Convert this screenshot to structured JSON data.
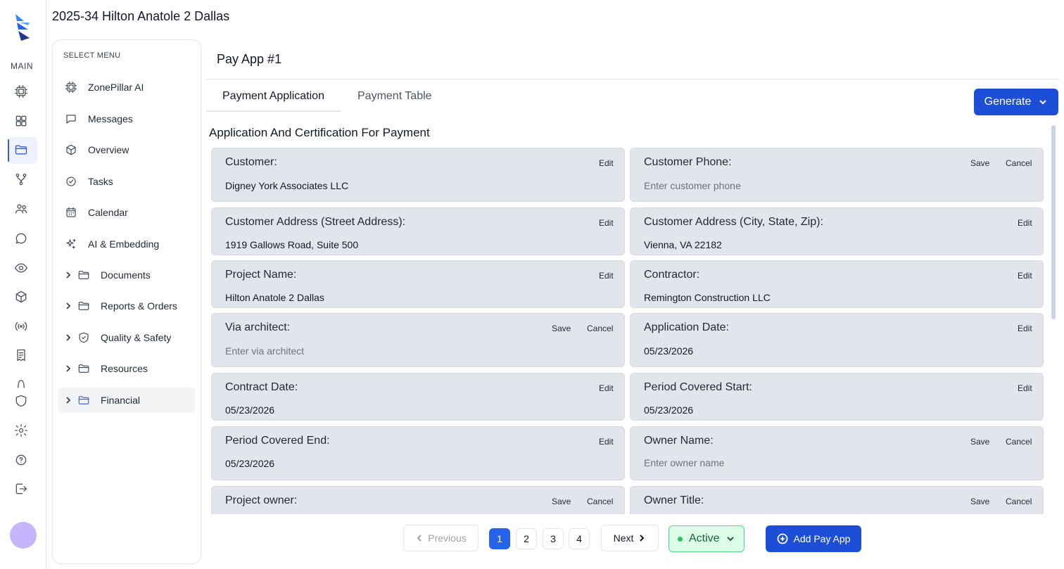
{
  "project_title": "2025-34 Hilton Anatole 2 Dallas",
  "rail": {
    "section_label": "MAIN",
    "icons": [
      "chip-icon",
      "grid-icon",
      "folder-icon",
      "branch-icon",
      "users-icon",
      "chat-icon",
      "eye-icon",
      "cube-icon",
      "broadcast-icon",
      "receipt-icon",
      "shield-icon",
      "settings-icon",
      "help-icon",
      "logout-icon"
    ]
  },
  "menu": {
    "heading": "SELECT MENU",
    "items": [
      {
        "label": "ZonePillar AI",
        "icon": "chip-icon"
      },
      {
        "label": "Messages",
        "icon": "message-icon"
      },
      {
        "label": "Overview",
        "icon": "cube-icon"
      },
      {
        "label": "Tasks",
        "icon": "check-circle-icon"
      },
      {
        "label": "Calendar",
        "icon": "calendar-icon"
      },
      {
        "label": "AI & Embedding",
        "icon": "sparkles-icon"
      },
      {
        "label": "Documents",
        "icon": "folder-icon"
      },
      {
        "label": "Reports & Orders",
        "icon": "folder-icon"
      },
      {
        "label": "Quality & Safety",
        "icon": "shield-check-icon"
      },
      {
        "label": "Resources",
        "icon": "folder-icon"
      },
      {
        "label": "Financial",
        "icon": "folder-icon",
        "active": true
      }
    ]
  },
  "pay_app": {
    "title": "Pay App #1",
    "tabs": [
      "Payment Application",
      "Payment Table"
    ],
    "active_tab": "Payment Application",
    "generate_label": "Generate",
    "section_title": "Application And Certification For Payment"
  },
  "fields": [
    {
      "label": "Customer:",
      "value": "Digney York Associates LLC",
      "mode": "edit"
    },
    {
      "label": "Customer Phone:",
      "placeholder": "Enter customer phone",
      "mode": "save"
    },
    {
      "label": "Customer Address (Street Address):",
      "value": "1919 Gallows Road, Suite 500",
      "mode": "edit"
    },
    {
      "label": "Customer Address (City, State, Zip):",
      "value": "Vienna, VA 22182",
      "mode": "edit"
    },
    {
      "label": "Project Name:",
      "value": "Hilton Anatole 2 Dallas",
      "mode": "edit"
    },
    {
      "label": "Contractor:",
      "value": "Remington Construction LLC",
      "mode": "edit"
    },
    {
      "label": "Via architect:",
      "placeholder": "Enter via architect",
      "mode": "save"
    },
    {
      "label": "Application Date:",
      "value": "05/23/2026",
      "mode": "edit"
    },
    {
      "label": "Contract Date:",
      "value": "05/23/2026",
      "mode": "edit"
    },
    {
      "label": "Period Covered Start:",
      "value": "05/23/2026",
      "mode": "edit"
    },
    {
      "label": "Period Covered End:",
      "value": "05/23/2026",
      "mode": "edit"
    },
    {
      "label": "Owner Name:",
      "placeholder": "Enter owner name",
      "mode": "save"
    },
    {
      "label": "Project owner:",
      "placeholder": "",
      "mode": "save"
    },
    {
      "label": "Owner Title:",
      "placeholder": "",
      "mode": "save"
    }
  ],
  "actions": {
    "edit": "Edit",
    "save": "Save",
    "cancel": "Cancel"
  },
  "pagination": {
    "previous": "Previous",
    "next": "Next",
    "pages": [
      "1",
      "2",
      "3",
      "4"
    ],
    "current": "1"
  },
  "status": {
    "label": "Active",
    "color": "#22c55e"
  },
  "add_button": "Add Pay App",
  "colors": {
    "accent": "#1d4ed8",
    "card_bg": "#e2e5eb",
    "status_bg": "#dcfce7"
  }
}
